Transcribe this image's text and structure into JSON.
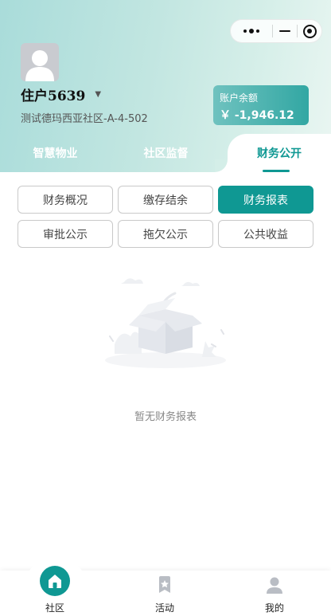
{
  "window": {
    "capsule": {
      "more_icon": "more-dots-icon",
      "minimize_icon": "minimize-icon",
      "close_icon": "target-close-icon"
    }
  },
  "profile": {
    "avatar_icon": "user-avatar-icon",
    "name": "住户5639",
    "switch_icon": "caret-down-icon",
    "address": "测试德玛西亚社区-A-4-502"
  },
  "balance": {
    "label": "账户余额",
    "amount": "￥ -1,946.12"
  },
  "tabs": [
    {
      "label": "智慧物业",
      "active": false
    },
    {
      "label": "社区监督",
      "active": false
    },
    {
      "label": "财务公开",
      "active": true
    }
  ],
  "filters": [
    {
      "label": "财务概况",
      "active": false
    },
    {
      "label": "缴存结余",
      "active": false
    },
    {
      "label": "财务报表",
      "active": true
    },
    {
      "label": "审批公示",
      "active": false
    },
    {
      "label": "拖欠公示",
      "active": false
    },
    {
      "label": "公共收益",
      "active": false
    }
  ],
  "empty": {
    "icon": "empty-box-icon",
    "text": "暂无财务报表"
  },
  "tabbar": [
    {
      "label": "社区",
      "icon": "home-icon",
      "active": true
    },
    {
      "label": "活动",
      "icon": "bookmark-star-icon",
      "active": false
    },
    {
      "label": "我的",
      "icon": "person-icon",
      "active": false
    }
  ],
  "colors": {
    "accent": "#0f9893",
    "header_gradient_start": "#a9dcda",
    "header_gradient_end": "#eaf6f2",
    "balance_card": "#32a7a3",
    "chip_border": "#c9c9c9",
    "muted_text": "#888888"
  }
}
